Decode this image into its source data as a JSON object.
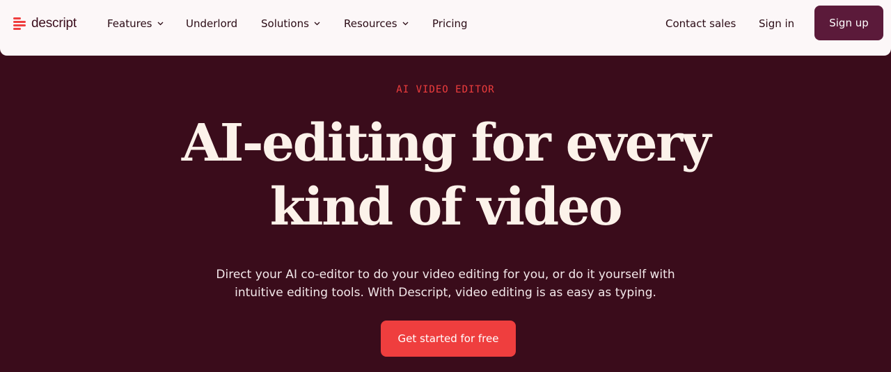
{
  "brand": {
    "name": "descript",
    "color": "#ef3e3e"
  },
  "nav": {
    "items": [
      {
        "label": "Features",
        "has_dropdown": true
      },
      {
        "label": "Underlord",
        "has_dropdown": false
      },
      {
        "label": "Solutions",
        "has_dropdown": true
      },
      {
        "label": "Resources",
        "has_dropdown": true
      },
      {
        "label": "Pricing",
        "has_dropdown": false
      }
    ],
    "contact_sales": "Contact sales",
    "sign_in": "Sign in",
    "sign_up": "Sign up"
  },
  "hero": {
    "eyebrow": "AI VIDEO EDITOR",
    "headline_line1": "AI-editing for every",
    "headline_line2": "kind of video",
    "subtitle_line1": "Direct your AI co-editor to do your video editing for you, or do it yourself with",
    "subtitle_line2": "intuitive editing tools. With Descript, video editing is as easy as typing.",
    "cta": "Get started for free"
  },
  "colors": {
    "background": "#3a0c1b",
    "nav_background": "#fcf7f8",
    "accent": "#ef3e3e",
    "sign_up_button": "#5b1a3a",
    "headline": "#fcf2ea"
  },
  "icons": {
    "logo": "descript-logo-icon",
    "dropdown": "chevron-down-icon"
  }
}
